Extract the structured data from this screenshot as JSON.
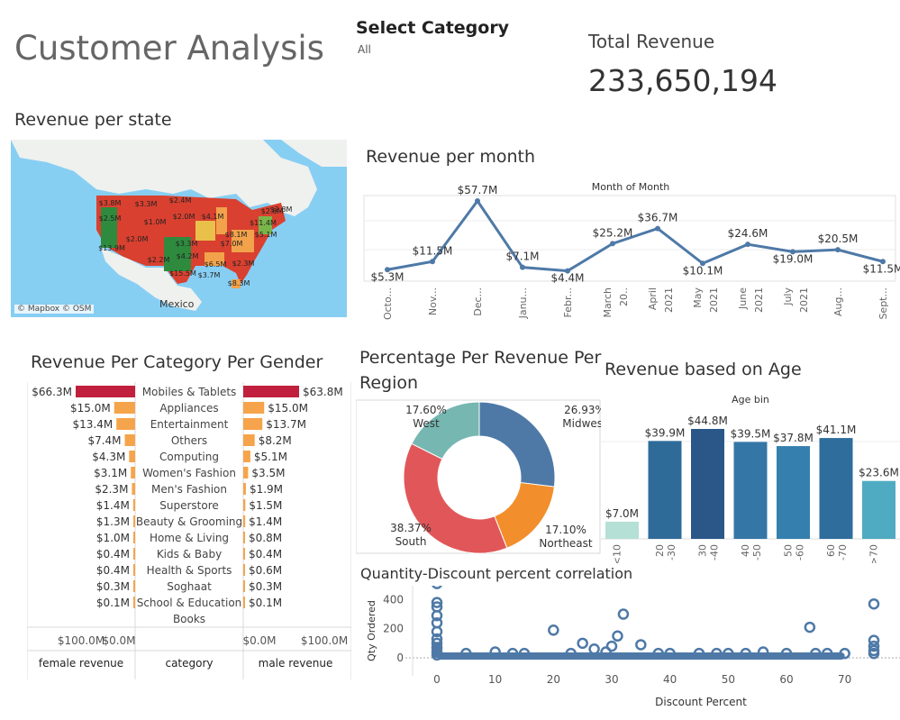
{
  "header": {
    "title": "Customer Analysis",
    "select_label": "Select Category",
    "select_value": "All",
    "total_revenue_label": "Total Revenue",
    "total_revenue_value": "233,650,194"
  },
  "map": {
    "title": "Revenue per state",
    "attribution": "© Mapbox © OSM",
    "country_label": "Mexico",
    "labels": [
      "$3.8M",
      "$3.3M",
      "$2.4M",
      "$2.8M",
      "$2.5M",
      "$1.0M",
      "$2.0M",
      "$4.1M",
      "$11.4M",
      "$2.8M",
      "$13.9M",
      "$2.0M",
      "$3.3M",
      "$8.1M",
      "$5.1M",
      "$7.0M",
      "$4.2M",
      "$2.2M",
      "$6.5M",
      "$2.3M",
      "$15.5M",
      "$3.7M",
      "$8.3M"
    ]
  },
  "month_chart": {
    "title": "Revenue per month",
    "subtitle": "Month of Month"
  },
  "gender_chart": {
    "title": "Revenue Per Category Per Gender",
    "axis_left": [
      "$100.0M",
      "$0.0M"
    ],
    "axis_right": [
      "$0.0M",
      "$100.0M"
    ],
    "col_female": "female revenue",
    "col_category": "category",
    "col_male": "male revenue"
  },
  "region_chart": {
    "title": "Percentage Per Revenue Per Region"
  },
  "age_chart": {
    "title": "Revenue based on Age",
    "subtitle": "Age bin"
  },
  "scatter_chart": {
    "title": "Quantity-Discount percent correlation",
    "xlabel": "Discount Percent",
    "ylabel": "Qty Ordered"
  },
  "chart_data": [
    {
      "type": "line",
      "id": "month",
      "title": "Month of Month",
      "categories": [
        "Octo...",
        "Nov...",
        "Dec...",
        "Janu...",
        "Febr...",
        "March 20..",
        "April 2021",
        "May 2021",
        "June 2021",
        "July 2021",
        "Aug...",
        "Sept..."
      ],
      "values": [
        5.3,
        11.5,
        57.7,
        7.1,
        4.4,
        25.2,
        36.7,
        10.1,
        24.6,
        19.0,
        20.5,
        11.5
      ],
      "data_labels": [
        "$5.3M",
        "$11.5M",
        "$57.7M",
        "$7.1M",
        "$4.4M",
        "$25.2M",
        "$36.7M",
        "$10.1M",
        "$24.6M",
        "$19.0M",
        "$20.5M",
        "$11.5M"
      ],
      "color": "#4e79a7"
    },
    {
      "type": "bar",
      "id": "gender",
      "categories": [
        "Mobiles & Tablets",
        "Appliances",
        "Entertainment",
        "Others",
        "Computing",
        "Women's Fashion",
        "Men's Fashion",
        "Superstore",
        "Beauty & Grooming",
        "Home & Living",
        "Kids & Baby",
        "Health & Sports",
        "Soghaat",
        "School & Education",
        "Books"
      ],
      "series": [
        {
          "name": "female revenue",
          "values": [
            66.3,
            15.0,
            13.4,
            7.4,
            4.3,
            3.1,
            2.3,
            1.4,
            1.3,
            1.0,
            0.4,
            0.4,
            0.3,
            0.1,
            null
          ],
          "labels": [
            "$66.3M",
            "$15.0M",
            "$13.4M",
            "$7.4M",
            "$4.3M",
            "$3.1M",
            "$2.3M",
            "$1.4M",
            "$1.3M",
            "$1.0M",
            "$0.4M",
            "$0.4M",
            "$0.3M",
            "$0.1M",
            ""
          ]
        },
        {
          "name": "male revenue",
          "values": [
            63.8,
            15.0,
            13.7,
            8.2,
            5.1,
            3.5,
            1.9,
            1.5,
            1.4,
            0.8,
            0.4,
            0.6,
            0.3,
            0.1,
            null
          ],
          "labels": [
            "$63.8M",
            "$15.0M",
            "$13.7M",
            "$8.2M",
            "$5.1M",
            "$3.5M",
            "$1.9M",
            "$1.5M",
            "$1.4M",
            "$0.8M",
            "$0.4M",
            "$0.6M",
            "$0.3M",
            "$0.1M",
            ""
          ]
        }
      ],
      "xlim": [
        0,
        100
      ],
      "highlight_color": "#c0203d",
      "bar_color": "#f6a44b"
    },
    {
      "type": "pie",
      "id": "region",
      "categories": [
        "Midwest",
        "Northeast",
        "South",
        "West"
      ],
      "values": [
        26.93,
        17.1,
        38.37,
        17.6
      ],
      "labels": [
        "26.93%",
        "17.10%",
        "38.37%",
        "17.60%"
      ],
      "colors": [
        "#4e79a7",
        "#f28e2b",
        "#e15759",
        "#76b7b2"
      ]
    },
    {
      "type": "bar",
      "id": "age",
      "title": "Age bin",
      "categories": [
        "<10",
        "20 -30",
        "30 -40",
        "40 -50",
        "50 -60",
        "60 -70",
        ">70"
      ],
      "values": [
        7.0,
        39.9,
        44.8,
        39.5,
        37.8,
        41.1,
        23.6
      ],
      "labels": [
        "$7.0M",
        "$39.9M",
        "$44.8M",
        "$39.5M",
        "$37.8M",
        "$41.1M",
        "$23.6M"
      ],
      "colors": [
        "#b5e0d6",
        "#2f6b99",
        "#2a5788",
        "#3476a6",
        "#347fae",
        "#2e6d9c",
        "#4fabc2"
      ]
    },
    {
      "type": "scatter",
      "id": "scatter",
      "xlabel": "Discount Percent",
      "ylabel": "Qty Ordered",
      "xlim": [
        0,
        75
      ],
      "ylim": [
        0,
        520
      ],
      "xticks": [
        0,
        10,
        20,
        30,
        40,
        50,
        60,
        70
      ],
      "yticks": [
        0,
        200,
        400
      ],
      "points": [
        [
          0,
          510
        ],
        [
          0,
          380
        ],
        [
          0,
          350
        ],
        [
          0,
          290
        ],
        [
          0,
          240
        ],
        [
          0,
          180
        ],
        [
          0,
          130
        ],
        [
          0,
          100
        ],
        [
          0,
          70
        ],
        [
          0,
          40
        ],
        [
          0,
          20
        ],
        [
          20,
          190
        ],
        [
          32,
          300
        ],
        [
          35,
          90
        ],
        [
          25,
          100
        ],
        [
          31,
          150
        ],
        [
          30,
          80
        ],
        [
          27,
          60
        ],
        [
          64,
          210
        ],
        [
          75,
          370
        ],
        [
          75,
          120
        ],
        [
          75,
          80
        ],
        [
          75,
          50
        ],
        [
          75,
          30
        ],
        [
          10,
          40
        ],
        [
          13,
          30
        ],
        [
          15,
          30
        ],
        [
          23,
          30
        ],
        [
          29,
          40
        ],
        [
          40,
          30
        ],
        [
          45,
          30
        ],
        [
          50,
          30
        ],
        [
          56,
          40
        ],
        [
          60,
          30
        ],
        [
          65,
          30
        ],
        [
          70,
          30
        ],
        [
          5,
          30
        ],
        [
          38,
          30
        ],
        [
          48,
          30
        ],
        [
          53,
          30
        ],
        [
          67,
          30
        ]
      ],
      "color": "#4e79a7"
    }
  ]
}
